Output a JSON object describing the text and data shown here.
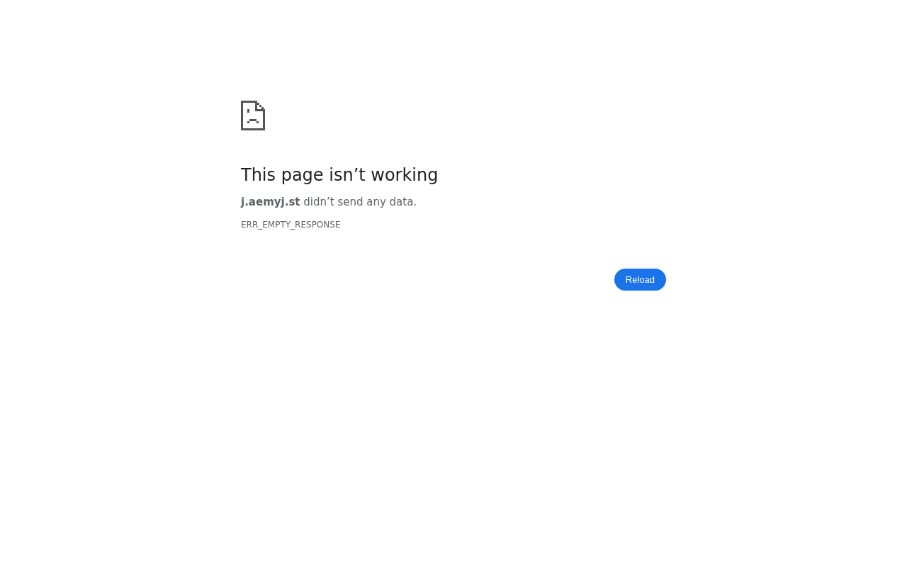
{
  "heading": "This page isn’t working",
  "message": "**j.aemyj.st** didn’t send any data.",
  "error_code": "ERR_EMPTY_RESPONSE",
  "buttons": [
    "Reload"
  ]
}
